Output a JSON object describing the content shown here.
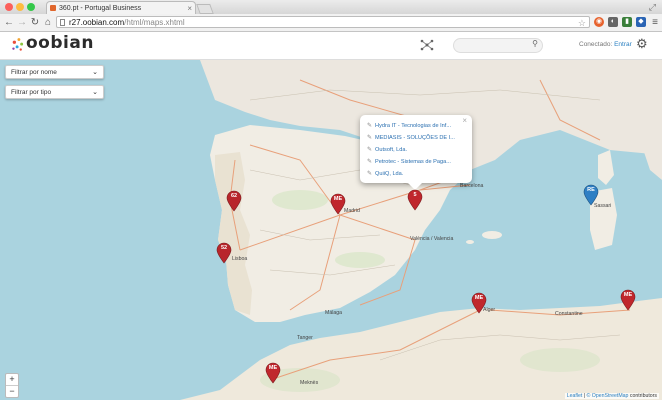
{
  "browser": {
    "tab_title": "360.pt - Portugal Business",
    "url_host": "r27.oobian.com",
    "url_path": "/html/maps.xhtml"
  },
  "header": {
    "logo_text": "oobian",
    "search_placeholder": "",
    "connected_label": "Conectado:",
    "logout_label": "Entrar"
  },
  "filters": {
    "by_name": "Filtrar por nome",
    "by_type": "Filtrar por tipo"
  },
  "popup": {
    "items": [
      "Hydra IT - Tecnologias de Inf...",
      "MEDIASIS - SOLUÇÕES DE I...",
      "Outsoft, Lda.",
      "Petrotec - Sistemas de Paga...",
      "QuiiQ, Lda."
    ]
  },
  "markers": [
    {
      "label": "62",
      "color": "#b8262b"
    },
    {
      "label": "ME",
      "color": "#c0272d"
    },
    {
      "label": "5",
      "color": "#c0272d"
    },
    {
      "label": "52",
      "color": "#b8262b"
    },
    {
      "label": "RE",
      "color": "#2e7fc4"
    },
    {
      "label": "ME",
      "color": "#c0272d"
    },
    {
      "label": "ME",
      "color": "#c0272d"
    },
    {
      "label": "ME",
      "color": "#c0272d"
    }
  ],
  "map_labels": {
    "madrid": "Madrid",
    "barcelona": "Barcelona",
    "valencia": "València / Valencia",
    "lisboa": "Lisboa",
    "alger": "Alger",
    "malaga": "Málaga",
    "sassari": "Sassari",
    "constantine": "Constantine",
    "tanger": "Tanger",
    "meknes": "Meknès"
  },
  "zoom": {
    "in": "+",
    "out": "−"
  },
  "attribution": {
    "leaflet": "Leaflet",
    "osm": "© OpenStreetMap",
    "contrib": "contributors"
  }
}
